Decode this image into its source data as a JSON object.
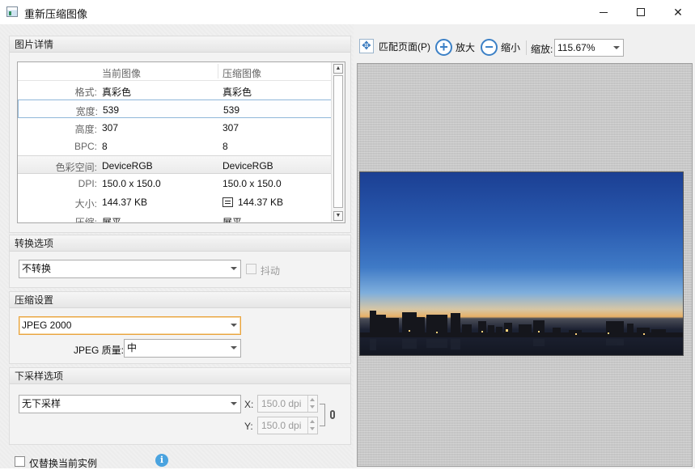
{
  "window": {
    "title": "重新压缩图像"
  },
  "details": {
    "header": "图片详情",
    "columns": [
      "",
      "当前图像",
      "压缩图像"
    ],
    "rows": [
      {
        "label": "格式:",
        "current": "真彩色",
        "compressed": "真彩色"
      },
      {
        "label": "宽度:",
        "current": "539",
        "compressed": "539"
      },
      {
        "label": "高度:",
        "current": "307",
        "compressed": "307"
      },
      {
        "label": "BPC:",
        "current": "8",
        "compressed": "8"
      },
      {
        "label": "色彩空间:",
        "current": "DeviceRGB",
        "compressed": "DeviceRGB"
      },
      {
        "label": "DPI:",
        "current": "150.0 x 150.0",
        "compressed": "150.0 x 150.0"
      },
      {
        "label": "大小:",
        "current": "144.37 KB",
        "compressed": "144.37 KB"
      },
      {
        "label": "压缩:",
        "current": "展平",
        "compressed": "展平"
      }
    ]
  },
  "convert": {
    "header": "转换选项",
    "selected": "不转换",
    "dither_label": "抖动"
  },
  "compress": {
    "header": "压缩设置",
    "method": "JPEG 2000",
    "quality_label": "JPEG 质量:",
    "quality": "中"
  },
  "downsample": {
    "header": "下采样选项",
    "selected": "无下采样",
    "x_label": "X:",
    "x_value": "150.0 dpi",
    "y_label": "Y:",
    "y_value": "150.0 dpi"
  },
  "bottom": {
    "replace_label": "仅替换当前实例",
    "info_glyph": "i"
  },
  "toolbar": {
    "fit_label": "匹配页面(P)",
    "zoom_in_label": "放大",
    "zoom_out_label": "缩小",
    "zoom_label": "缩放:",
    "zoom_value": "115.67%",
    "plus": "+",
    "minus": "−"
  },
  "icons": {
    "fit": "fit-page-icon",
    "zoom_in": "zoom-in-icon",
    "zoom_out": "zoom-out-icon",
    "chain": "chain-link-icon",
    "info": "info-icon"
  }
}
